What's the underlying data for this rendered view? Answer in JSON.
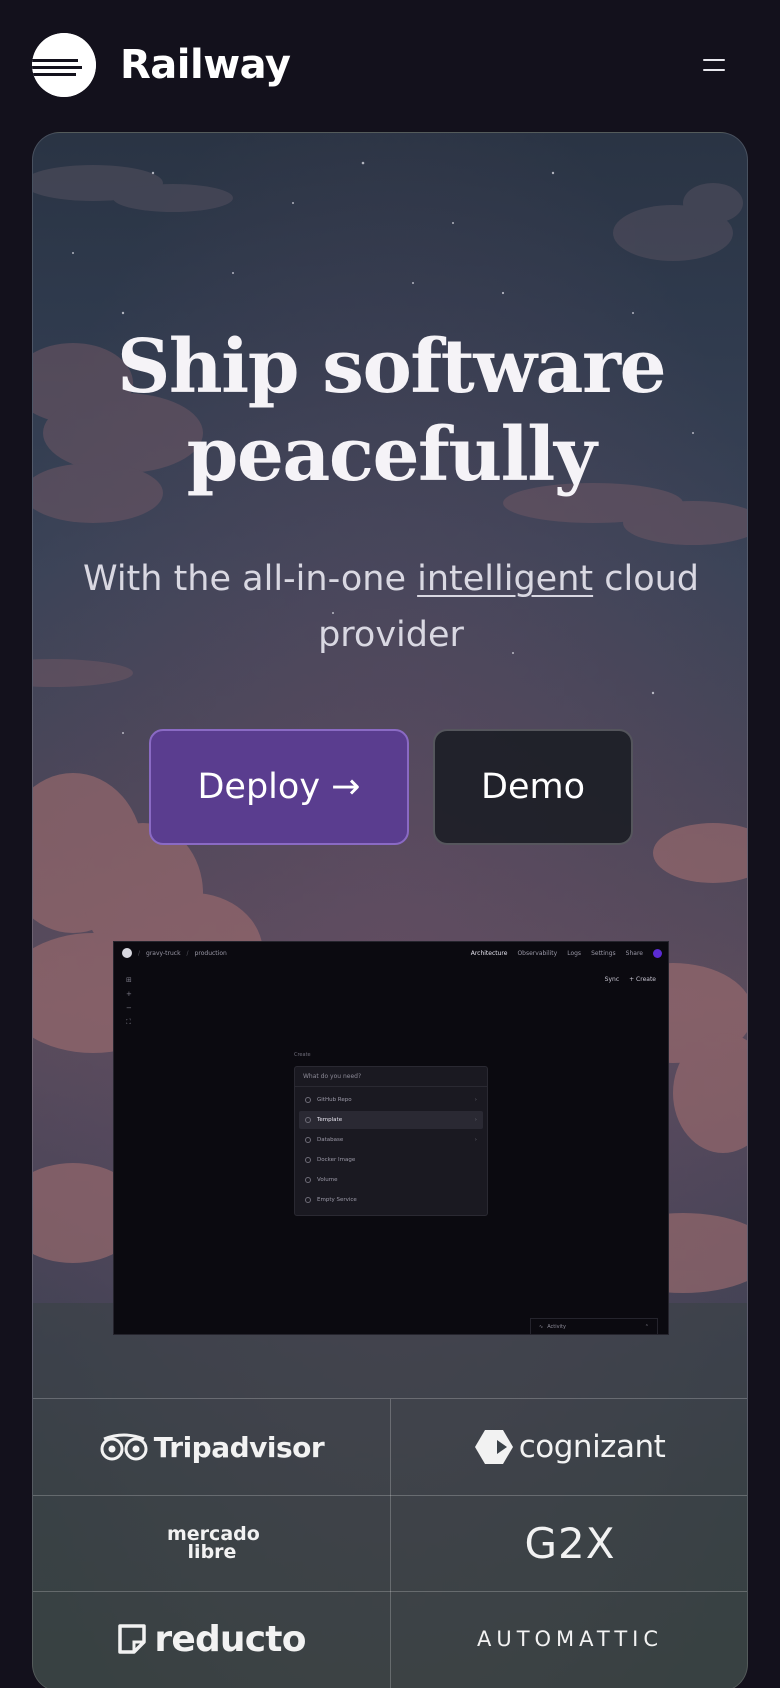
{
  "header": {
    "brand_name": "Railway",
    "menu_icon": "hamburger-menu-icon"
  },
  "hero": {
    "title_line1": "Ship software",
    "title_line2": "peacefully",
    "subtitle_pre": "With the all-in-one ",
    "subtitle_underline": "intelligent",
    "subtitle_post": " cloud provider",
    "deploy_label": "Deploy →",
    "demo_label": "Demo"
  },
  "mockup": {
    "project": "gravy-truck",
    "environment": "production",
    "nav": [
      "Architecture",
      "Observability",
      "Logs",
      "Settings"
    ],
    "share_label": "Share",
    "sync_label": "Sync",
    "create_label": "+ Create",
    "panel_label": "Create",
    "search_placeholder": "What do you need?",
    "items": [
      {
        "label": "GitHub Repo",
        "has_chevron": true
      },
      {
        "label": "Template",
        "has_chevron": true,
        "selected": true
      },
      {
        "label": "Database",
        "has_chevron": true
      },
      {
        "label": "Docker Image",
        "has_chevron": false
      },
      {
        "label": "Volume",
        "has_chevron": false
      },
      {
        "label": "Empty Service",
        "has_chevron": false
      }
    ],
    "activity_label": "Activity",
    "accent": "#5b2bd4"
  },
  "logos": [
    "Tripadvisor",
    "cognizant",
    "mercado libre",
    "G2X",
    "reducto",
    "AUTOMATTIC"
  ],
  "colors": {
    "background": "#13111c",
    "deploy_button": "#5a3d8f",
    "demo_button": "#161a20"
  }
}
